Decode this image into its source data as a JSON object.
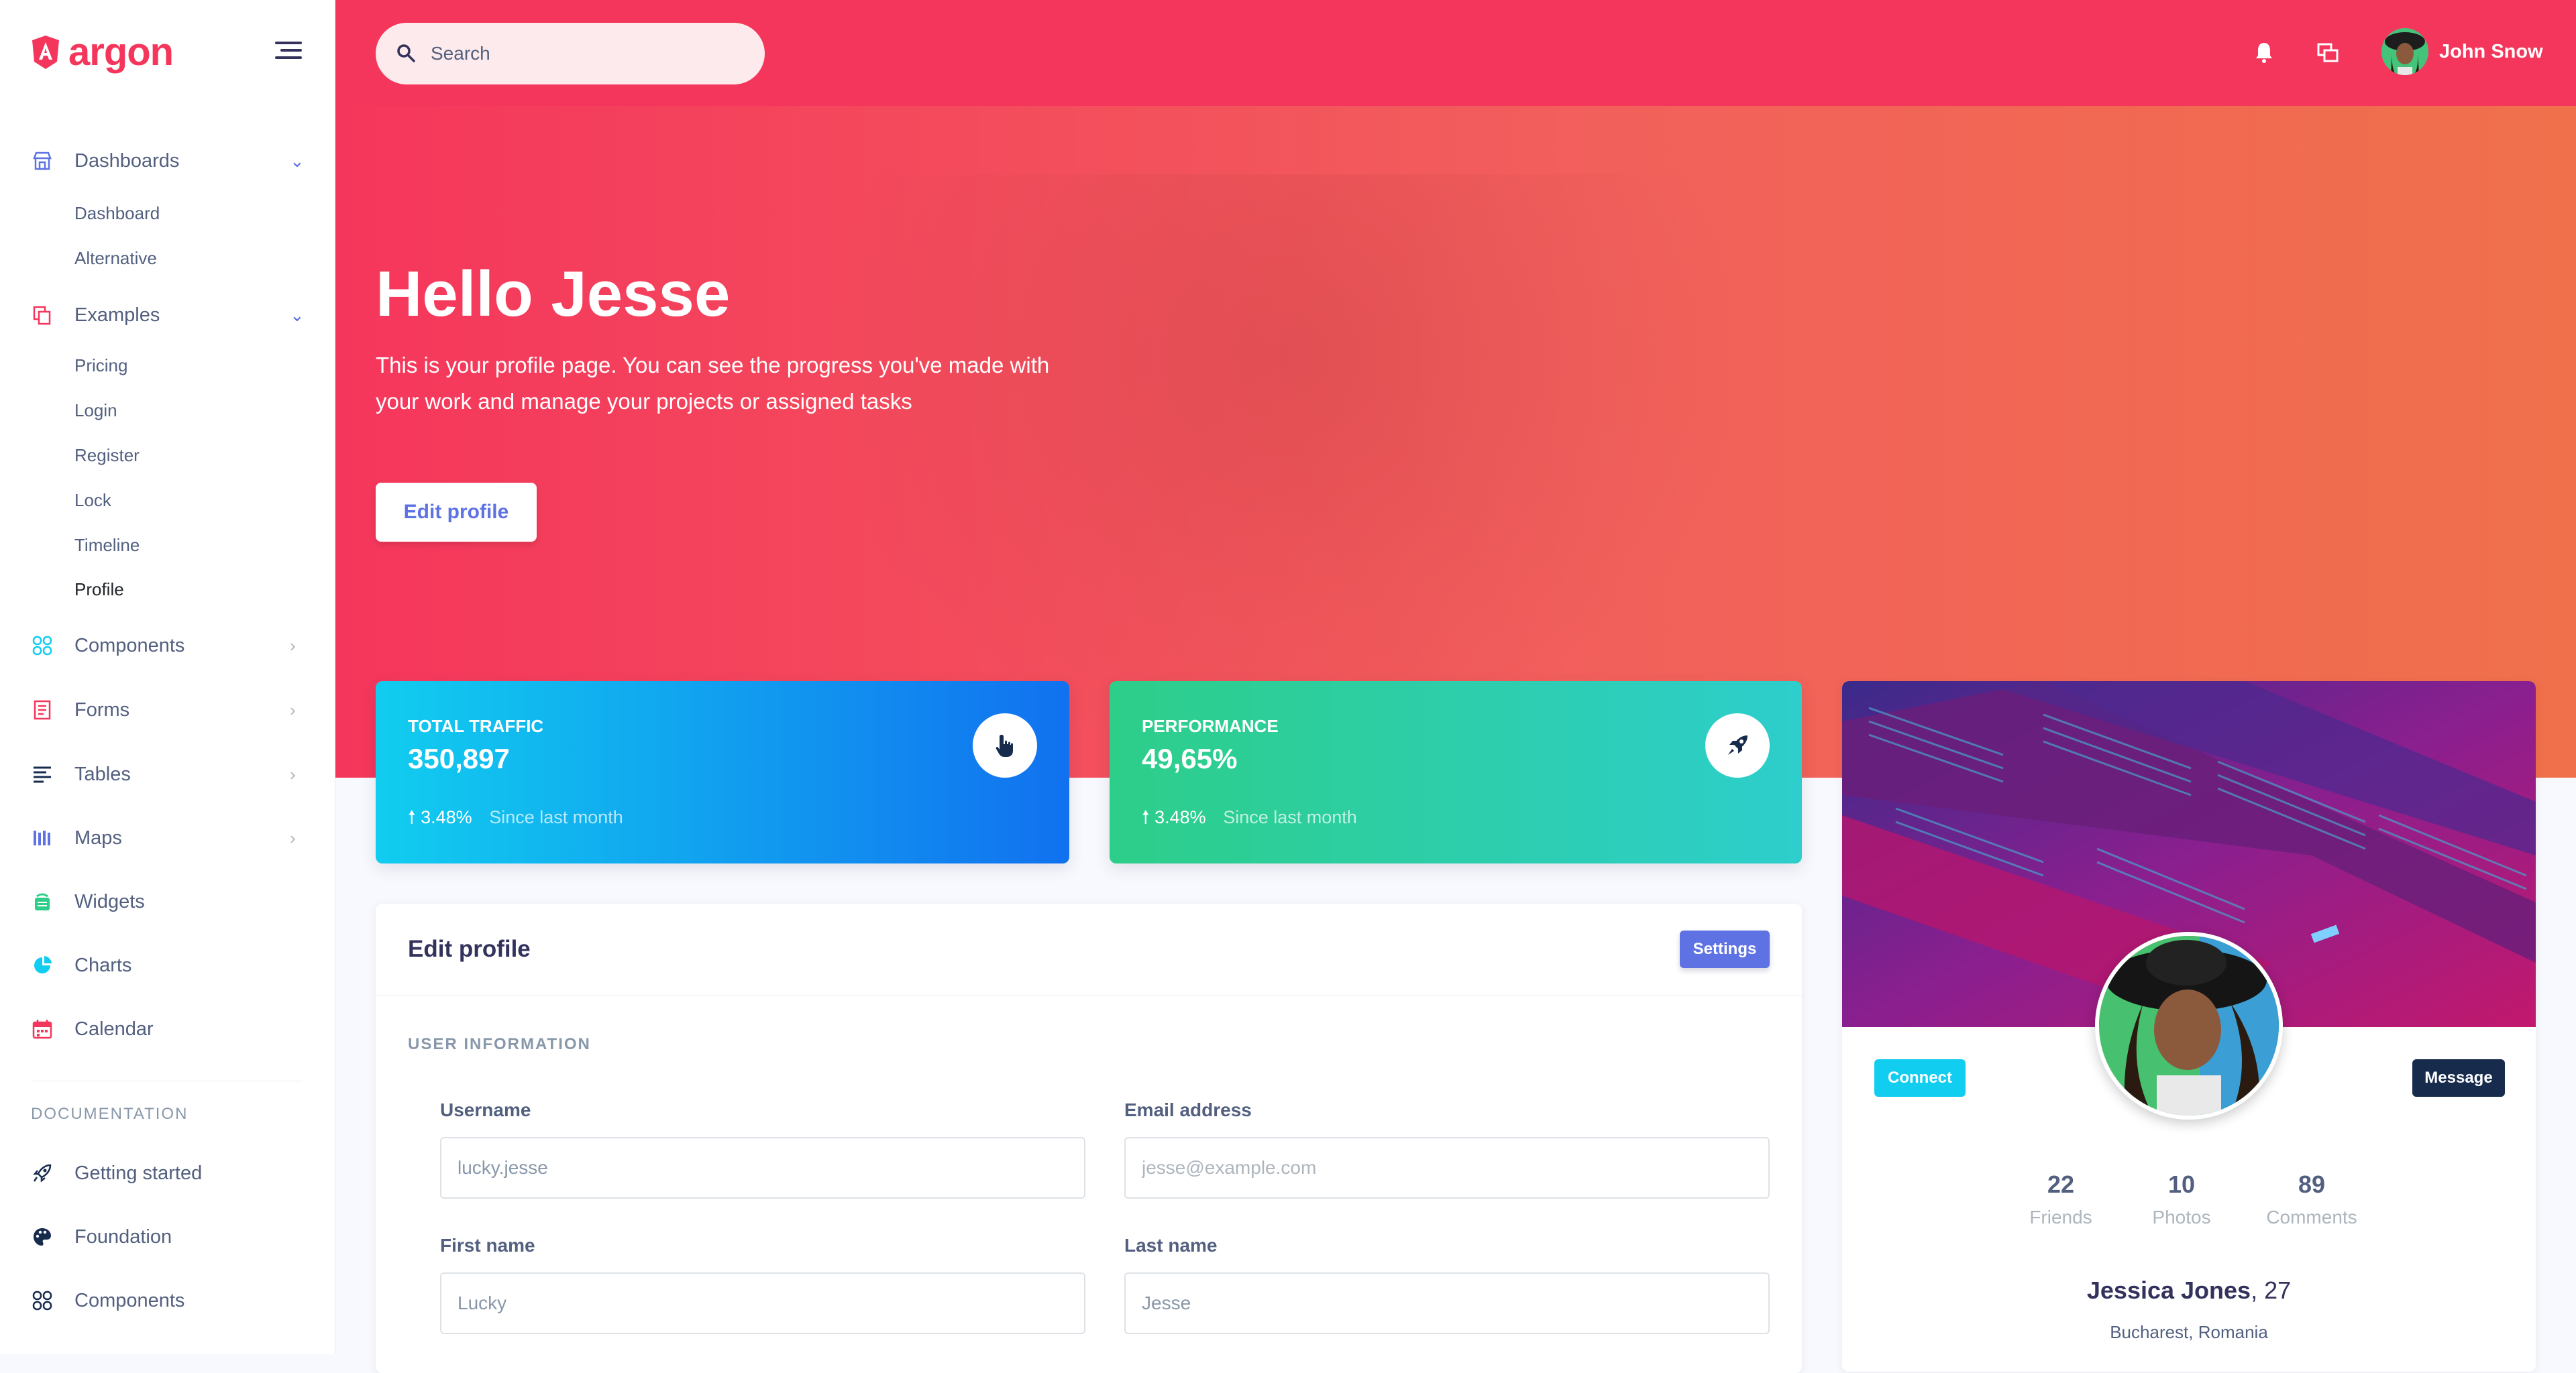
{
  "brand": {
    "name": "argon"
  },
  "sidebar": {
    "groups": [
      {
        "label": "Dashboards",
        "icon": "shop-icon",
        "expanded": true,
        "children": [
          "Dashboard",
          "Alternative"
        ]
      },
      {
        "label": "Examples",
        "icon": "single-copy-icon",
        "expanded": true,
        "children": [
          "Pricing",
          "Login",
          "Register",
          "Lock",
          "Timeline",
          "Profile"
        ],
        "active_child": "Profile"
      },
      {
        "label": "Components",
        "icon": "components-icon",
        "expanded": false
      },
      {
        "label": "Forms",
        "icon": "forms-icon",
        "expanded": false
      },
      {
        "label": "Tables",
        "icon": "tables-icon",
        "expanded": false
      },
      {
        "label": "Maps",
        "icon": "maps-icon",
        "expanded": false
      },
      {
        "label": "Widgets",
        "icon": "widgets-icon"
      },
      {
        "label": "Charts",
        "icon": "charts-icon"
      },
      {
        "label": "Calendar",
        "icon": "calendar-icon"
      }
    ],
    "doc_heading": "DOCUMENTATION",
    "doc_items": [
      {
        "label": "Getting started",
        "icon": "rocket-icon"
      },
      {
        "label": "Foundation",
        "icon": "palette-icon"
      },
      {
        "label": "Components",
        "icon": "components-icon"
      }
    ]
  },
  "topbar": {
    "search_placeholder": "Search",
    "user_name": "John Snow"
  },
  "hero": {
    "title": "Hello Jesse",
    "description": "This is your profile page. You can see the progress you've made with your work and manage your projects or assigned tasks",
    "button": "Edit profile"
  },
  "stats": [
    {
      "title": "TOTAL TRAFFIC",
      "value": "350,897",
      "change": "3.48%",
      "since": "Since last month",
      "icon": "pointer-icon"
    },
    {
      "title": "PERFORMANCE",
      "value": "49,65%",
      "change": "3.48%",
      "since": "Since last month",
      "icon": "spaceship-icon"
    }
  ],
  "edit_card": {
    "title": "Edit profile",
    "settings_button": "Settings",
    "section": "USER INFORMATION",
    "fields": [
      {
        "label": "Username",
        "value": "lucky.jesse",
        "placeholder": ""
      },
      {
        "label": "Email address",
        "value": "",
        "placeholder": "jesse@example.com"
      },
      {
        "label": "First name",
        "value": "Lucky",
        "placeholder": ""
      },
      {
        "label": "Last name",
        "value": "Jesse",
        "placeholder": ""
      }
    ]
  },
  "profile_card": {
    "connect": "Connect",
    "message": "Message",
    "stats": [
      {
        "value": "22",
        "label": "Friends"
      },
      {
        "value": "10",
        "label": "Photos"
      },
      {
        "value": "89",
        "label": "Comments"
      }
    ],
    "name": "Jessica Jones",
    "age": ", 27",
    "location": "Bucharest, Romania"
  },
  "colors": {
    "primary": "#5e72e4",
    "danger": "#f5365c",
    "info": "#11cdef",
    "success": "#2dce89",
    "dark": "#172b4d"
  }
}
